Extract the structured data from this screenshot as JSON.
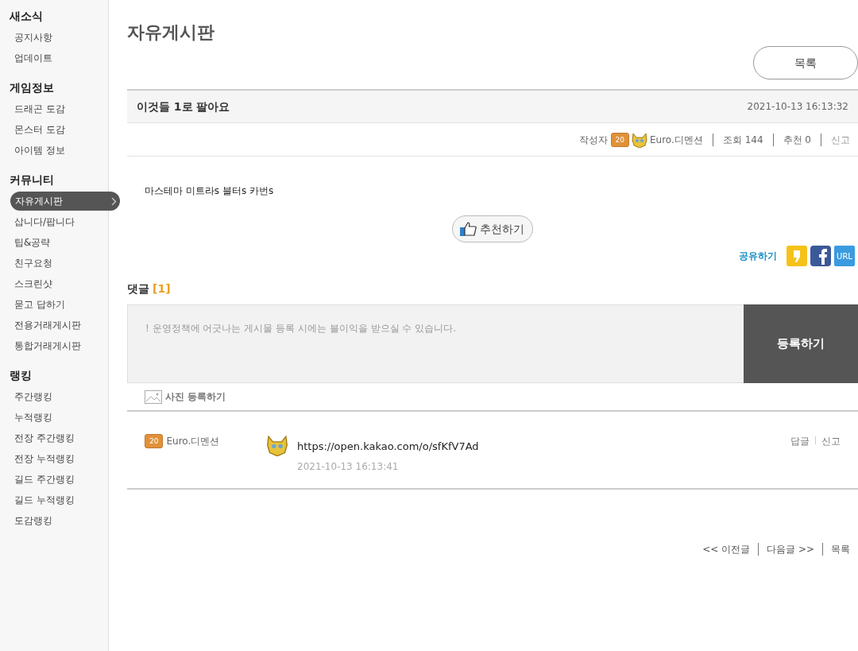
{
  "sidebar": {
    "sections": [
      {
        "title": "새소식",
        "items": [
          {
            "label": "공지사항",
            "selected": false
          },
          {
            "label": "업데이트",
            "selected": false
          }
        ]
      },
      {
        "title": "게임정보",
        "items": [
          {
            "label": "드래곤 도감",
            "selected": false
          },
          {
            "label": "몬스터 도감",
            "selected": false
          },
          {
            "label": "아이템 정보",
            "selected": false
          }
        ]
      },
      {
        "title": "커뮤니티",
        "items": [
          {
            "label": "자유게시판",
            "selected": true
          },
          {
            "label": "삽니다/팝니다",
            "selected": false
          },
          {
            "label": "팁&공략",
            "selected": false
          },
          {
            "label": "친구요청",
            "selected": false
          },
          {
            "label": "스크린샷",
            "selected": false
          },
          {
            "label": "묻고 답하기",
            "selected": false
          },
          {
            "label": "전용거래게시판",
            "selected": false
          },
          {
            "label": "통합거래게시판",
            "selected": false
          }
        ]
      },
      {
        "title": "랭킹",
        "items": [
          {
            "label": "주간랭킹",
            "selected": false
          },
          {
            "label": "누적랭킹",
            "selected": false
          },
          {
            "label": "전장 주간랭킹",
            "selected": false
          },
          {
            "label": "전장 누적랭킹",
            "selected": false
          },
          {
            "label": "길드 주간랭킹",
            "selected": false
          },
          {
            "label": "길드 누적랭킹",
            "selected": false
          },
          {
            "label": "도감랭킹",
            "selected": false
          }
        ]
      }
    ]
  },
  "page_title": "자유게시판",
  "list_button": "목록",
  "post": {
    "title": "이것들 1로 팔아요",
    "date": "2021-10-13 16:13:32",
    "author_label": "작성자",
    "level": "20",
    "author": "Euro.디멘션",
    "views": "조회 144",
    "recommends": "추천 0",
    "report": "신고",
    "body": "마스테마 미트라s 블터s 카번s"
  },
  "recommend_button": "추천하기",
  "share": {
    "label": "공유하기",
    "url_label": "URL"
  },
  "comments": {
    "title": "댓글",
    "count": "[1]",
    "placeholder": "! 운영정책에 어긋나는 게시물 등록 시에는 불이익을 받으실 수 있습니다.",
    "submit": "등록하기",
    "photo_button": "사진 등록하기",
    "items": [
      {
        "level": "20",
        "author": "Euro.디멘션",
        "text": "https://open.kakao.com/o/sfKfV7Ad",
        "date": "2021-10-13 16:13:41",
        "reply": "답글",
        "report": "신고"
      }
    ]
  },
  "post_nav": [
    "<< 이전글",
    "다음글 >>",
    "목록"
  ]
}
